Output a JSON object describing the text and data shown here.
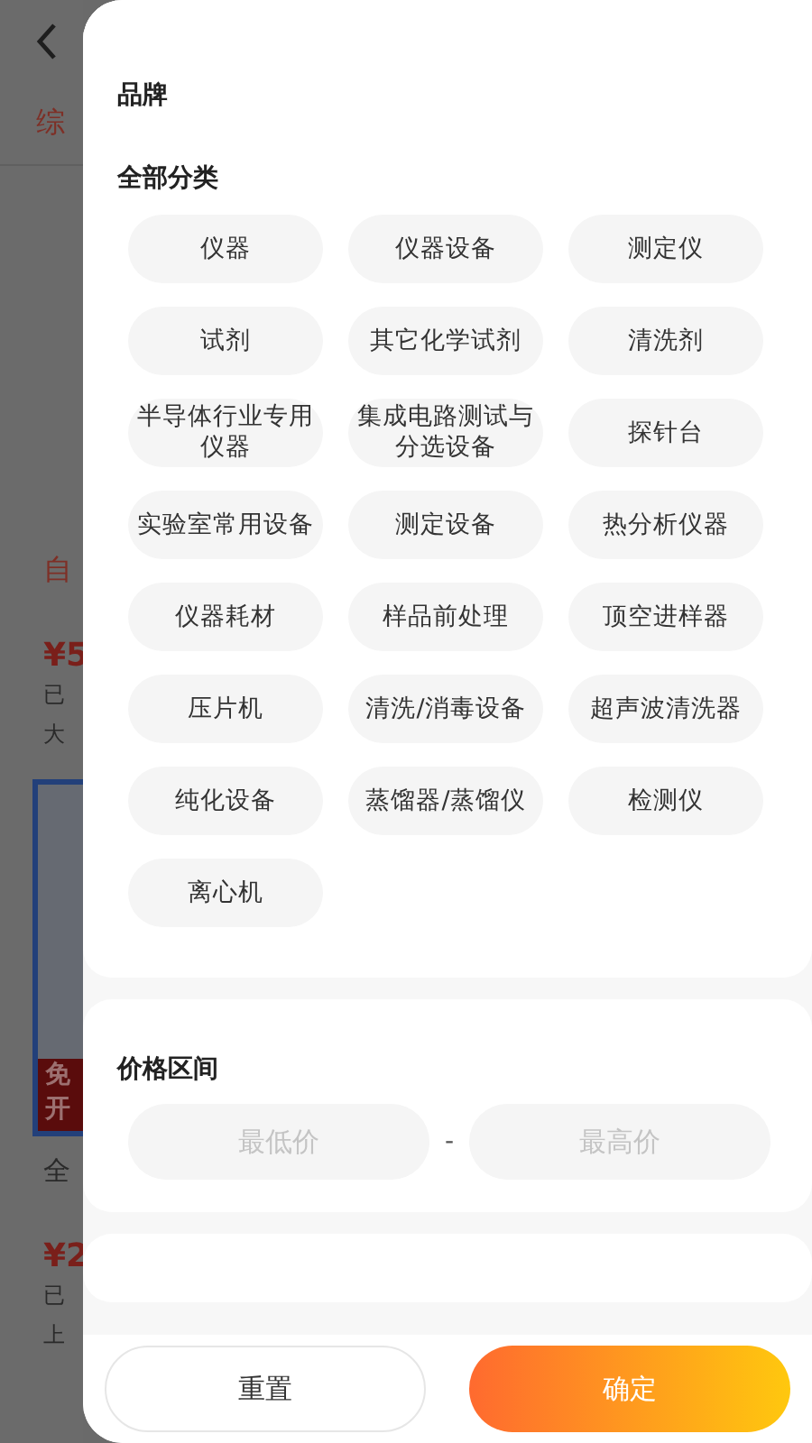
{
  "background_page": {
    "tab": "综",
    "section": "自",
    "items": [
      {
        "price": "¥5",
        "line_1": "已",
        "line_2": "大"
      },
      {
        "price": "¥2",
        "line_1": "已",
        "line_2": "上"
      }
    ],
    "banner": {
      "line_1": "免",
      "line_2": "开"
    },
    "caption": "全"
  },
  "filter": {
    "brand_title": "品牌",
    "category_title": "全部分类",
    "categories": [
      {
        "label": "仪器",
        "selected": false
      },
      {
        "label": "仪器设备",
        "selected": false
      },
      {
        "label": "测定仪",
        "selected": false
      },
      {
        "label": "试剂",
        "selected": false
      },
      {
        "label": "其它化学试剂",
        "selected": false
      },
      {
        "label": "清洗剂",
        "selected": false
      },
      {
        "label": "半导体行业专用仪器",
        "selected": false
      },
      {
        "label": "集成电路测试与分选设备",
        "selected": false
      },
      {
        "label": "探针台",
        "selected": false
      },
      {
        "label": "实验室常用设备",
        "selected": false
      },
      {
        "label": "测定设备",
        "selected": false
      },
      {
        "label": "热分析仪器",
        "selected": false
      },
      {
        "label": "仪器耗材",
        "selected": false
      },
      {
        "label": "样品前处理",
        "selected": false
      },
      {
        "label": "顶空进样器",
        "selected": false
      },
      {
        "label": "压片机",
        "selected": false
      },
      {
        "label": "清洗/消毒设备",
        "selected": false
      },
      {
        "label": "超声波清洗器",
        "selected": false
      },
      {
        "label": "纯化设备",
        "selected": false
      },
      {
        "label": "蒸馏器/蒸馏仪",
        "selected": false
      },
      {
        "label": "检测仪",
        "selected": false
      },
      {
        "label": "离心机",
        "selected": false
      }
    ],
    "price_title": "价格区间",
    "min_placeholder": "最低价",
    "separator": "-",
    "max_placeholder": "最高价",
    "buttons": {
      "reset": "重置",
      "confirm": "确定"
    }
  }
}
